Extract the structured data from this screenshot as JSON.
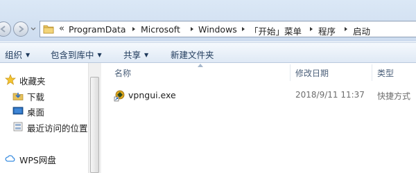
{
  "address_bar": {
    "overflow": "«",
    "crumbs": [
      "ProgramData",
      "Microsoft",
      "Windows",
      "「开始」菜单",
      "程序",
      "启动"
    ]
  },
  "command_bar": {
    "organize": "组织",
    "include_in_library": "包含到库中",
    "share": "共享",
    "new_folder": "新建文件夹"
  },
  "nav_pane": {
    "favorites": "收藏夹",
    "downloads": "下载",
    "desktop": "桌面",
    "recent": "最近访问的位置",
    "wps": "WPS网盘"
  },
  "columns": {
    "name": "名称",
    "modified": "修改日期",
    "type": "类型"
  },
  "files": [
    {
      "name": "vpngui.exe",
      "modified": "2018/9/11 11:37",
      "type": "快捷方式"
    }
  ],
  "colors": {
    "header_bg": "#dbe8f6",
    "cmd_text": "#1e395b",
    "column_header_text": "#4c607a",
    "meta_text": "#6d6d6d"
  },
  "icons": {
    "back": "arrow-left-icon",
    "forward": "arrow-right-icon",
    "folder": "folder-icon",
    "favorites": "star-icon",
    "downloads": "download-icon",
    "desktop": "desktop-icon",
    "recent": "recent-places-icon",
    "wps": "cloud-icon",
    "file": "shortcut-app-icon"
  }
}
